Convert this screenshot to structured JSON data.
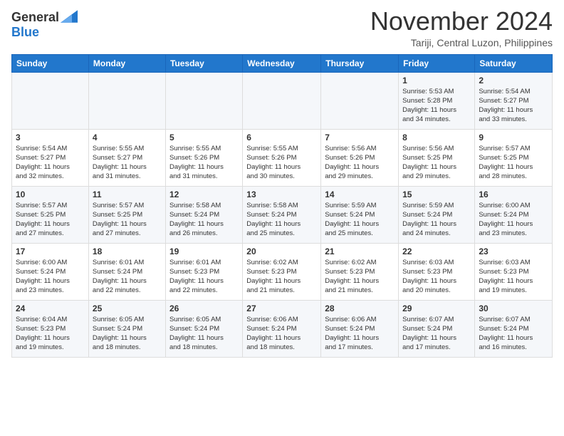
{
  "header": {
    "logo_general": "General",
    "logo_blue": "Blue",
    "month_title": "November 2024",
    "location": "Tariji, Central Luzon, Philippines"
  },
  "calendar": {
    "weekdays": [
      "Sunday",
      "Monday",
      "Tuesday",
      "Wednesday",
      "Thursday",
      "Friday",
      "Saturday"
    ],
    "weeks": [
      [
        {
          "day": "",
          "info": ""
        },
        {
          "day": "",
          "info": ""
        },
        {
          "day": "",
          "info": ""
        },
        {
          "day": "",
          "info": ""
        },
        {
          "day": "",
          "info": ""
        },
        {
          "day": "1",
          "info": "Sunrise: 5:53 AM\nSunset: 5:28 PM\nDaylight: 11 hours\nand 34 minutes."
        },
        {
          "day": "2",
          "info": "Sunrise: 5:54 AM\nSunset: 5:27 PM\nDaylight: 11 hours\nand 33 minutes."
        }
      ],
      [
        {
          "day": "3",
          "info": "Sunrise: 5:54 AM\nSunset: 5:27 PM\nDaylight: 11 hours\nand 32 minutes."
        },
        {
          "day": "4",
          "info": "Sunrise: 5:55 AM\nSunset: 5:27 PM\nDaylight: 11 hours\nand 31 minutes."
        },
        {
          "day": "5",
          "info": "Sunrise: 5:55 AM\nSunset: 5:26 PM\nDaylight: 11 hours\nand 31 minutes."
        },
        {
          "day": "6",
          "info": "Sunrise: 5:55 AM\nSunset: 5:26 PM\nDaylight: 11 hours\nand 30 minutes."
        },
        {
          "day": "7",
          "info": "Sunrise: 5:56 AM\nSunset: 5:26 PM\nDaylight: 11 hours\nand 29 minutes."
        },
        {
          "day": "8",
          "info": "Sunrise: 5:56 AM\nSunset: 5:25 PM\nDaylight: 11 hours\nand 29 minutes."
        },
        {
          "day": "9",
          "info": "Sunrise: 5:57 AM\nSunset: 5:25 PM\nDaylight: 11 hours\nand 28 minutes."
        }
      ],
      [
        {
          "day": "10",
          "info": "Sunrise: 5:57 AM\nSunset: 5:25 PM\nDaylight: 11 hours\nand 27 minutes."
        },
        {
          "day": "11",
          "info": "Sunrise: 5:57 AM\nSunset: 5:25 PM\nDaylight: 11 hours\nand 27 minutes."
        },
        {
          "day": "12",
          "info": "Sunrise: 5:58 AM\nSunset: 5:24 PM\nDaylight: 11 hours\nand 26 minutes."
        },
        {
          "day": "13",
          "info": "Sunrise: 5:58 AM\nSunset: 5:24 PM\nDaylight: 11 hours\nand 25 minutes."
        },
        {
          "day": "14",
          "info": "Sunrise: 5:59 AM\nSunset: 5:24 PM\nDaylight: 11 hours\nand 25 minutes."
        },
        {
          "day": "15",
          "info": "Sunrise: 5:59 AM\nSunset: 5:24 PM\nDaylight: 11 hours\nand 24 minutes."
        },
        {
          "day": "16",
          "info": "Sunrise: 6:00 AM\nSunset: 5:24 PM\nDaylight: 11 hours\nand 23 minutes."
        }
      ],
      [
        {
          "day": "17",
          "info": "Sunrise: 6:00 AM\nSunset: 5:24 PM\nDaylight: 11 hours\nand 23 minutes."
        },
        {
          "day": "18",
          "info": "Sunrise: 6:01 AM\nSunset: 5:24 PM\nDaylight: 11 hours\nand 22 minutes."
        },
        {
          "day": "19",
          "info": "Sunrise: 6:01 AM\nSunset: 5:23 PM\nDaylight: 11 hours\nand 22 minutes."
        },
        {
          "day": "20",
          "info": "Sunrise: 6:02 AM\nSunset: 5:23 PM\nDaylight: 11 hours\nand 21 minutes."
        },
        {
          "day": "21",
          "info": "Sunrise: 6:02 AM\nSunset: 5:23 PM\nDaylight: 11 hours\nand 21 minutes."
        },
        {
          "day": "22",
          "info": "Sunrise: 6:03 AM\nSunset: 5:23 PM\nDaylight: 11 hours\nand 20 minutes."
        },
        {
          "day": "23",
          "info": "Sunrise: 6:03 AM\nSunset: 5:23 PM\nDaylight: 11 hours\nand 19 minutes."
        }
      ],
      [
        {
          "day": "24",
          "info": "Sunrise: 6:04 AM\nSunset: 5:23 PM\nDaylight: 11 hours\nand 19 minutes."
        },
        {
          "day": "25",
          "info": "Sunrise: 6:05 AM\nSunset: 5:24 PM\nDaylight: 11 hours\nand 18 minutes."
        },
        {
          "day": "26",
          "info": "Sunrise: 6:05 AM\nSunset: 5:24 PM\nDaylight: 11 hours\nand 18 minutes."
        },
        {
          "day": "27",
          "info": "Sunrise: 6:06 AM\nSunset: 5:24 PM\nDaylight: 11 hours\nand 18 minutes."
        },
        {
          "day": "28",
          "info": "Sunrise: 6:06 AM\nSunset: 5:24 PM\nDaylight: 11 hours\nand 17 minutes."
        },
        {
          "day": "29",
          "info": "Sunrise: 6:07 AM\nSunset: 5:24 PM\nDaylight: 11 hours\nand 17 minutes."
        },
        {
          "day": "30",
          "info": "Sunrise: 6:07 AM\nSunset: 5:24 PM\nDaylight: 11 hours\nand 16 minutes."
        }
      ]
    ]
  }
}
